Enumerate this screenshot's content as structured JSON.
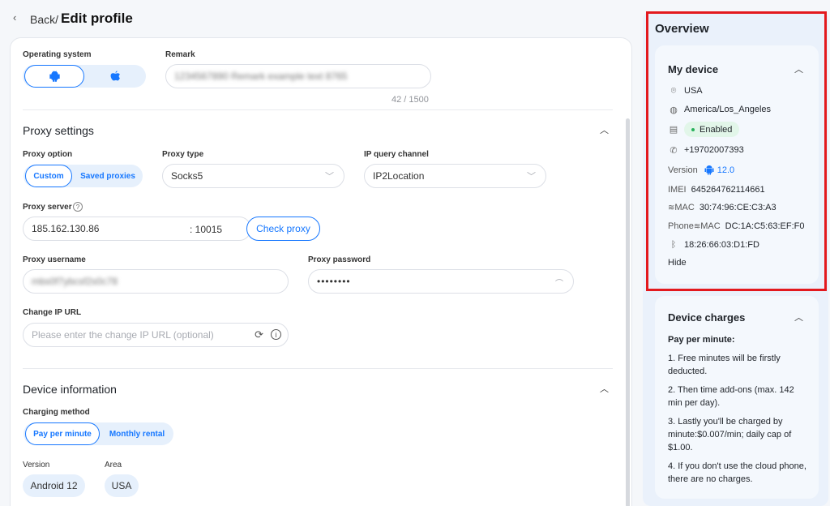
{
  "header": {
    "back_arrow": "‹",
    "back_label": "Back/",
    "title": "Edit profile"
  },
  "basic": {
    "os_label": "Operating system",
    "os_options": [
      "android-icon",
      "apple-icon"
    ],
    "remark_label": "Remark",
    "remark_value": "1234567890 Remark example text 8765",
    "remark_counter": "42 / 1500"
  },
  "proxy": {
    "title": "Proxy settings",
    "option_label": "Proxy option",
    "option_custom": "Custom",
    "option_saved": "Saved proxies",
    "type_label": "Proxy type",
    "type_value": "Socks5",
    "channel_label": "IP query channel",
    "channel_value": "IP2Location",
    "server_label": "Proxy server",
    "server_ip": "185.162.130.86",
    "server_port": ": 10015",
    "check_button": "Check proxy",
    "username_label": "Proxy username",
    "username_value": "mbs0f7ybcsf2s0c78",
    "password_label": "Proxy password",
    "password_value": "••••••••",
    "change_ip_label": "Change IP URL",
    "change_ip_placeholder": "Please enter the change IP URL (optional)"
  },
  "device": {
    "title": "Device information",
    "charging_label": "Charging method",
    "charging_per_minute": "Pay per minute",
    "charging_monthly": "Monthly rental",
    "version_label": "Version",
    "version_value": "Android 12",
    "area_label": "Area",
    "area_value": "USA"
  },
  "overview": {
    "title": "Overview",
    "my_device": {
      "title": "My device",
      "country": "USA",
      "timezone": "America/Los_Angeles",
      "sim_status": "Enabled",
      "phone": "+19702007393",
      "version_label": "Version",
      "version_value": "12.0",
      "imei_label": "IMEI",
      "imei_value": "645264762114661",
      "mac_label": "MAC",
      "mac_value": "30:74:96:CE:C3:A3",
      "phone_mac_label": "Phone",
      "phone_mac_label2": "MAC",
      "phone_mac_value": "DC:1A:C5:63:EF:F0",
      "bt_value": "18:26:66:03:D1:FD",
      "hide": "Hide"
    },
    "charges": {
      "title": "Device charges",
      "heading": "Pay per minute:",
      "items": [
        "1. Free minutes will be firstly deducted.",
        "2. Then time add-ons (max. 142 min per day).",
        "3. Lastly you'll be charged by minute:$0.007/min; daily cap of $1.00.",
        "4. If you don't use the cloud phone, there are no charges."
      ]
    }
  },
  "colors": {
    "accent": "#1677ff",
    "highlight_box": "#e3191e",
    "enabled_bg": "#e2f6e9"
  }
}
